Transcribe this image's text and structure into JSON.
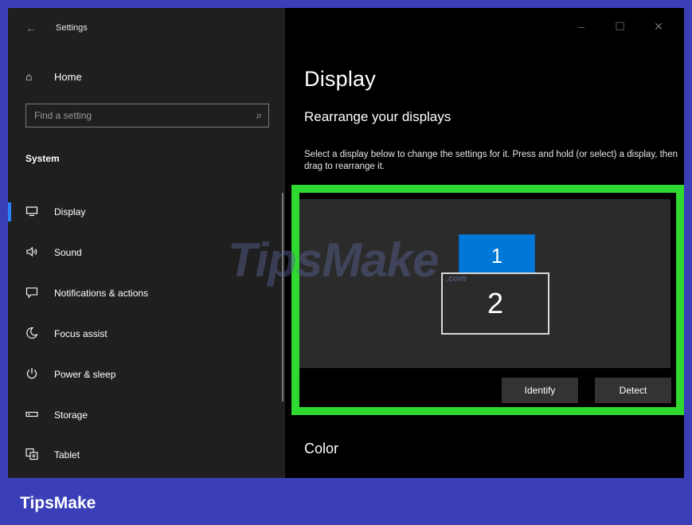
{
  "window": {
    "title": "Settings",
    "controls": {
      "minimize": "–",
      "maximize": "☐",
      "close": "✕"
    }
  },
  "sidebar": {
    "home_label": "Home",
    "search_placeholder": "Find a setting",
    "section_label": "System",
    "items": [
      {
        "label": "Display",
        "icon": "monitor-icon",
        "active": true
      },
      {
        "label": "Sound",
        "icon": "speaker-icon"
      },
      {
        "label": "Notifications & actions",
        "icon": "notification-icon"
      },
      {
        "label": "Focus assist",
        "icon": "moon-icon"
      },
      {
        "label": "Power & sleep",
        "icon": "power-icon"
      },
      {
        "label": "Storage",
        "icon": "storage-icon"
      },
      {
        "label": "Tablet",
        "icon": "tablet-icon"
      }
    ]
  },
  "main": {
    "title": "Display",
    "subtitle": "Rearrange your displays",
    "instructions": "Select a display below to change the settings for it. Press and hold (or select) a display, then drag to rearrange it.",
    "monitors": [
      {
        "number": "1",
        "selected": true
      },
      {
        "number": "2"
      }
    ],
    "identify_label": "Identify",
    "detect_label": "Detect",
    "color_heading": "Color"
  },
  "watermark": {
    "text": "TipsMake",
    "suffix": ".com"
  },
  "footer": {
    "brand": "TipsMake"
  },
  "colors": {
    "accent": "#0078d7",
    "highlight": "#2fd92f",
    "frame": "#3a3fb8"
  }
}
